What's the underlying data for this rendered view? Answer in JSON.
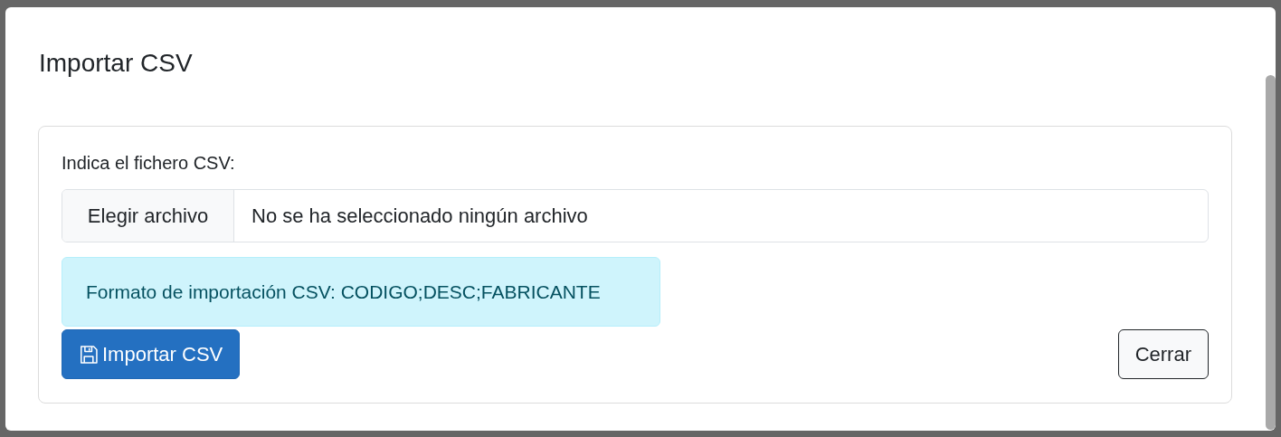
{
  "modal": {
    "title": "Importar CSV"
  },
  "form": {
    "label": "Indica el fichero CSV:",
    "file_button": "Elegir archivo",
    "file_status": "No se ha seleccionado ningún archivo"
  },
  "alert": {
    "text": "Formato de importación CSV: CODIGO;DESC;FABRICANTE"
  },
  "buttons": [
    {
      "kind": "primary",
      "label": "Importar CSV"
    },
    {
      "kind": "secondary",
      "label": "Cerrar"
    }
  ]
}
